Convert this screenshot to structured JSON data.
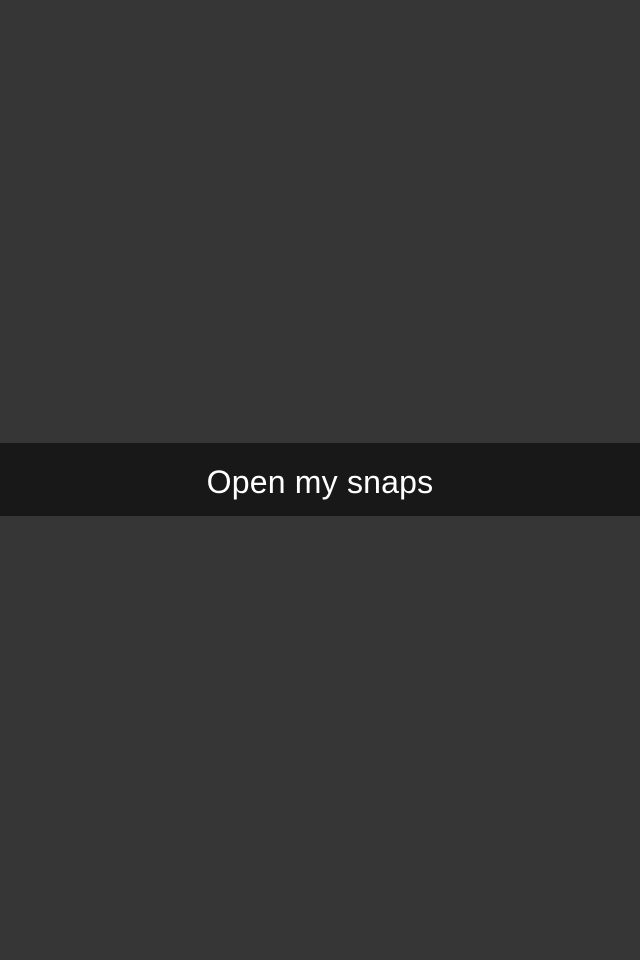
{
  "snap": {
    "caption": "Open my snaps"
  },
  "colors": {
    "background": "#363636",
    "caption_bar": "#161616",
    "caption_text": "#ffffff"
  }
}
